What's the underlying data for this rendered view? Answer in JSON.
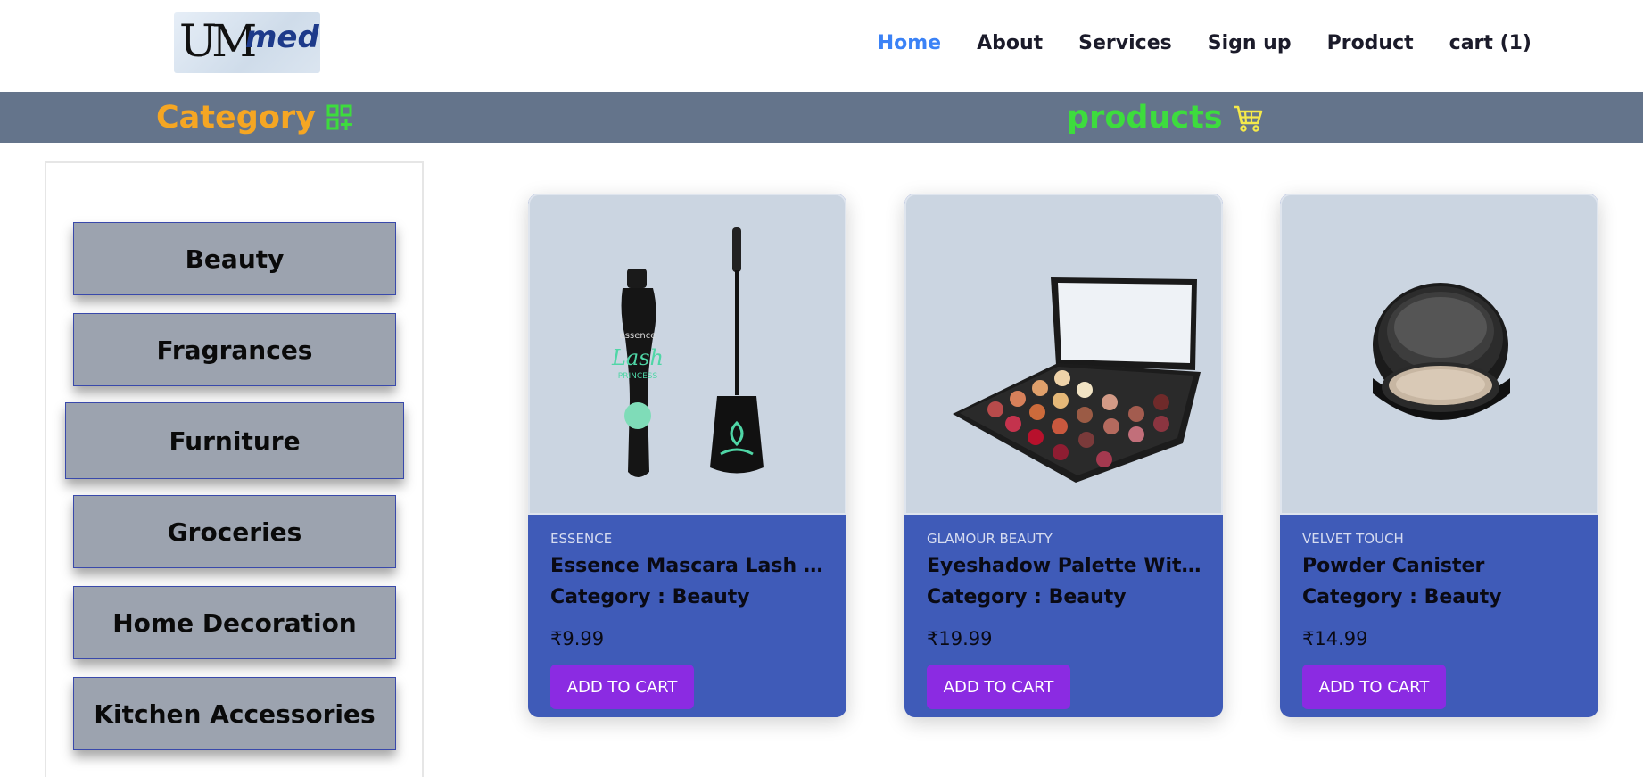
{
  "brand": {
    "logo_mark": "UM",
    "logo_word": "med"
  },
  "nav": {
    "items": [
      {
        "label": "Home",
        "active": true
      },
      {
        "label": "About"
      },
      {
        "label": "Services"
      },
      {
        "label": "Sign up"
      },
      {
        "label": "Product"
      },
      {
        "label": "cart (1)"
      }
    ]
  },
  "banner": {
    "category_title": "Category",
    "category_icon": "category-grid-add-icon",
    "products_title": "products",
    "products_icon": "shopping-cart-icon",
    "colors": {
      "background": "#64748b",
      "category": "#f5a623",
      "products": "#3ddc3d"
    }
  },
  "sidebar": {
    "categories": [
      {
        "label": "Beauty"
      },
      {
        "label": "Fragrances"
      },
      {
        "label": "Furniture",
        "active": true
      },
      {
        "label": "Groceries"
      },
      {
        "label": "Home Decoration"
      },
      {
        "label": "Kitchen Accessories"
      }
    ]
  },
  "products": [
    {
      "brand": "ESSENCE",
      "name": "Essence Mascara Lash Princ...",
      "category": "Category : Beauty",
      "price": "₹9.99",
      "button": "ADD TO CART",
      "image": "mascara"
    },
    {
      "brand": "GLAMOUR BEAUTY",
      "name": "Eyeshadow Palette With Mi...",
      "category": "Category : Beauty",
      "price": "₹19.99",
      "button": "ADD TO CART",
      "image": "eyeshadow-palette"
    },
    {
      "brand": "VELVET TOUCH",
      "name": "Powder Canister",
      "category": "Category : Beauty",
      "price": "₹14.99",
      "button": "ADD TO CART",
      "image": "powder-canister"
    }
  ],
  "colors": {
    "accent": "#3b82f6",
    "card": "#3f5bb8",
    "button": "#8b2be2",
    "category_button": "#9ca3af"
  }
}
